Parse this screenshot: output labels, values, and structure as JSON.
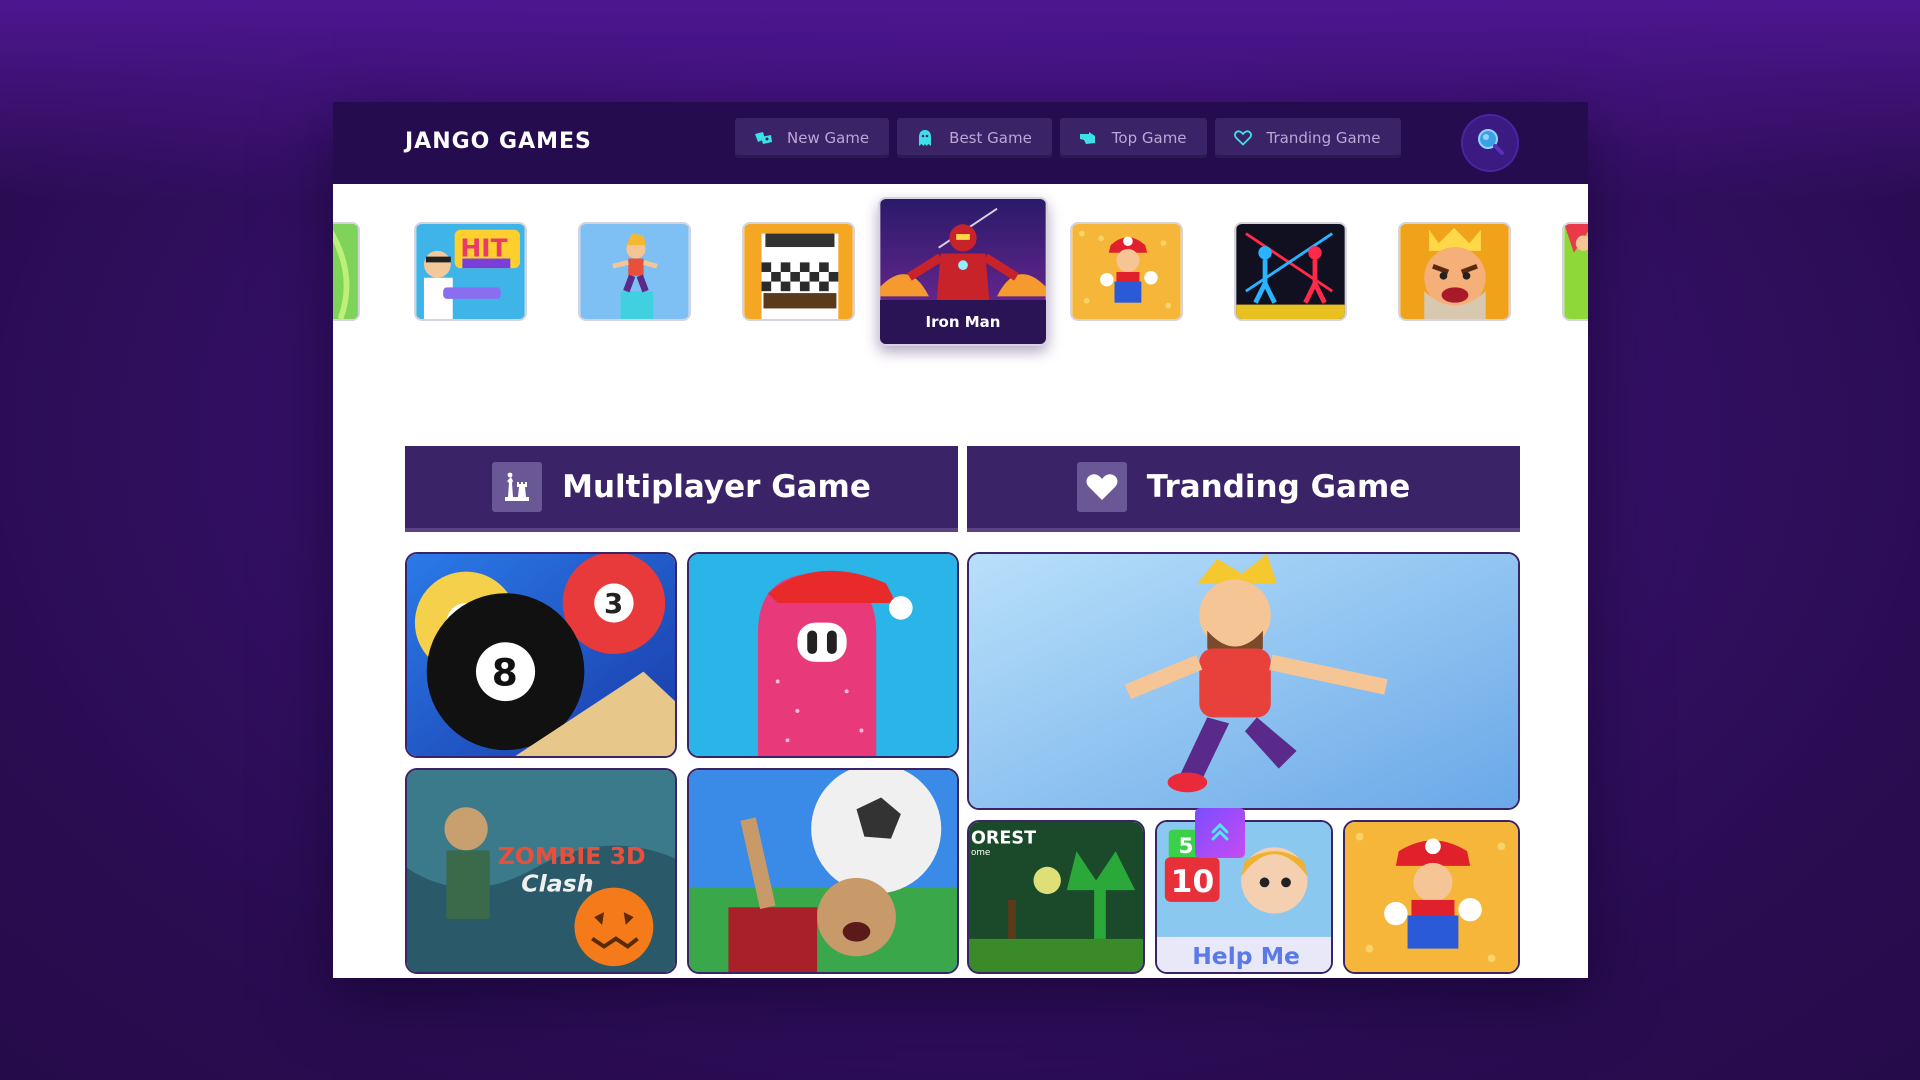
{
  "header": {
    "brand": "JANGO GAMES",
    "nav": [
      {
        "label": "New Game",
        "icon": "gamepad-icon"
      },
      {
        "label": "Best Game",
        "icon": "ghost-icon"
      },
      {
        "label": "Top Game",
        "icon": "hand-pointer-icon"
      },
      {
        "label": "Tranding Game",
        "icon": "heart-icon"
      }
    ],
    "search_icon": "search-icon"
  },
  "carousel": {
    "active_label": "Iron Man",
    "items": [
      "green-game",
      "hit-masters",
      "stickman-runner",
      "chess-game",
      "iron-man",
      "super-mario",
      "stickman-fight",
      "angry-king",
      "green-game-2"
    ]
  },
  "sections": {
    "multiplayer": {
      "title": "Multiplayer Game",
      "icon": "chess-pieces-icon"
    },
    "trending": {
      "title": "Tranding Game",
      "icon": "heart-icon"
    }
  },
  "tiles": {
    "zombie_title": "ZOMBIE 3D",
    "zombie_subtitle": "Clash",
    "forest_text": "OREST",
    "forest_sub": "ome",
    "help_text": "Help Me",
    "help_num_5": "5",
    "help_num_10": "10"
  },
  "colors": {
    "header": "#240c4f",
    "section_bar": "#3a2366",
    "accent": "#7b4dff"
  }
}
